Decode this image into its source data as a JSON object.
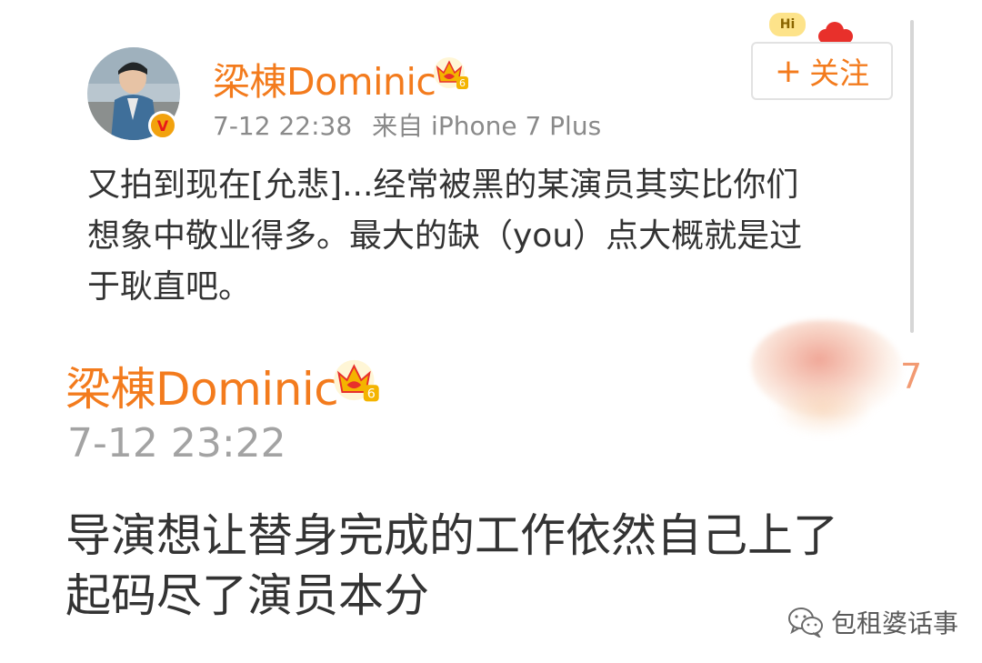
{
  "post": {
    "username": "梁棟Dominic",
    "meta": {
      "time": "7-12 22:38",
      "source": "来自 iPhone 7 Plus"
    },
    "follow_label": "关注",
    "follow_plus": "+",
    "hi_label": "Hi",
    "level": "6",
    "text_lines": [
      "又拍到现在[允悲]...经常被黑的某演员其实比你们",
      "想象中敬业得多。最大的缺（you）点大概就是过",
      "于耿直吧。"
    ]
  },
  "comment": {
    "username": "梁棟Dominic",
    "level": "6",
    "time": "7-12 23:22",
    "text_lines": [
      "导演想让替身完成的工作依然自己上了",
      "起码尽了演员本分"
    ],
    "peek_char": "7"
  },
  "watermark": {
    "text": "包租婆话事"
  },
  "colors": {
    "brand_orange": "#f37b1d",
    "text_main": "#333333",
    "text_meta": "#8a8a8a",
    "crown_gold": "#f4b400",
    "crown_red": "#e8302b",
    "verified_gold": "#f2a20e"
  },
  "icons": {
    "crown": "vip-crown-icon",
    "verified": "verified-v-icon",
    "wechat": "wechat-icon",
    "cloud": "red-cloud-icon"
  }
}
